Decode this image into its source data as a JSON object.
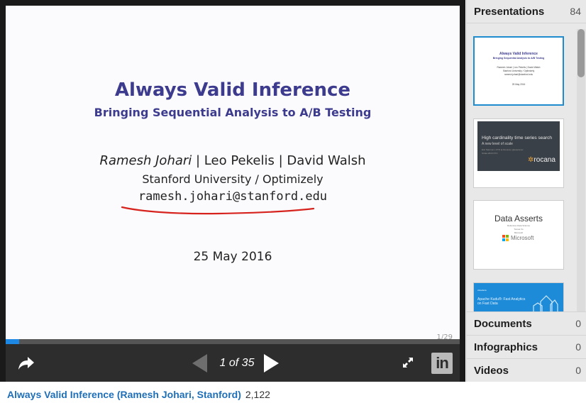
{
  "slide": {
    "title": "Always Valid Inference",
    "subtitle": "Bringing Sequential Analysis to A/B Testing",
    "author_first": "Ramesh Johari",
    "author_rest": " | Leo Pekelis | David Walsh",
    "affiliation": "Stanford University / Optimizely",
    "email": "ramesh.johari@stanford.edu",
    "date": "25 May 2016",
    "page_marker": "1/29"
  },
  "player": {
    "counter": "1 of 35",
    "progress": 0.03,
    "linkedin_label": "in",
    "colors": {
      "accent": "#1e88e5",
      "control_bg": "#2d2d2d",
      "title_color": "#3d3b8e"
    }
  },
  "sidebar": {
    "presentations": {
      "label": "Presentations",
      "count": "84"
    },
    "thumbnails": [
      {
        "title": "Always Valid Inference",
        "subtitle": "Bringing Sequential Analysis to A/B Testing",
        "authors": "Ramesh Johari | Leo Pekelis | David Walsh",
        "affiliation": "Stanford University / Optimizely",
        "email": "ramesh.johari@stanford.edu",
        "date": "25 May 2016"
      },
      {
        "title": "High cardinality time series search",
        "subtitle": "A new level of scale",
        "small": "Eric Sammer | CTO at Rocana | @esammer",
        "small2": "Strata 2016 NYC",
        "logo": "rocana"
      },
      {
        "title": "Data Asserts",
        "line1": "Defensive Data Science",
        "line2": "Tomas Vo",
        "line3": "Microsoft",
        "logo": "Microsoft"
      },
      {
        "tag": "cloudera",
        "title": "Apache Kudu®: Fast Analytics on Fast Data"
      }
    ],
    "documents": {
      "label": "Documents",
      "count": "0"
    },
    "infographics": {
      "label": "Infographics",
      "count": "0"
    },
    "videos": {
      "label": "Videos",
      "count": "0"
    }
  },
  "caption": {
    "title": "Always Valid Inference (Ramesh Johari, Stanford)",
    "views": "2,122"
  }
}
